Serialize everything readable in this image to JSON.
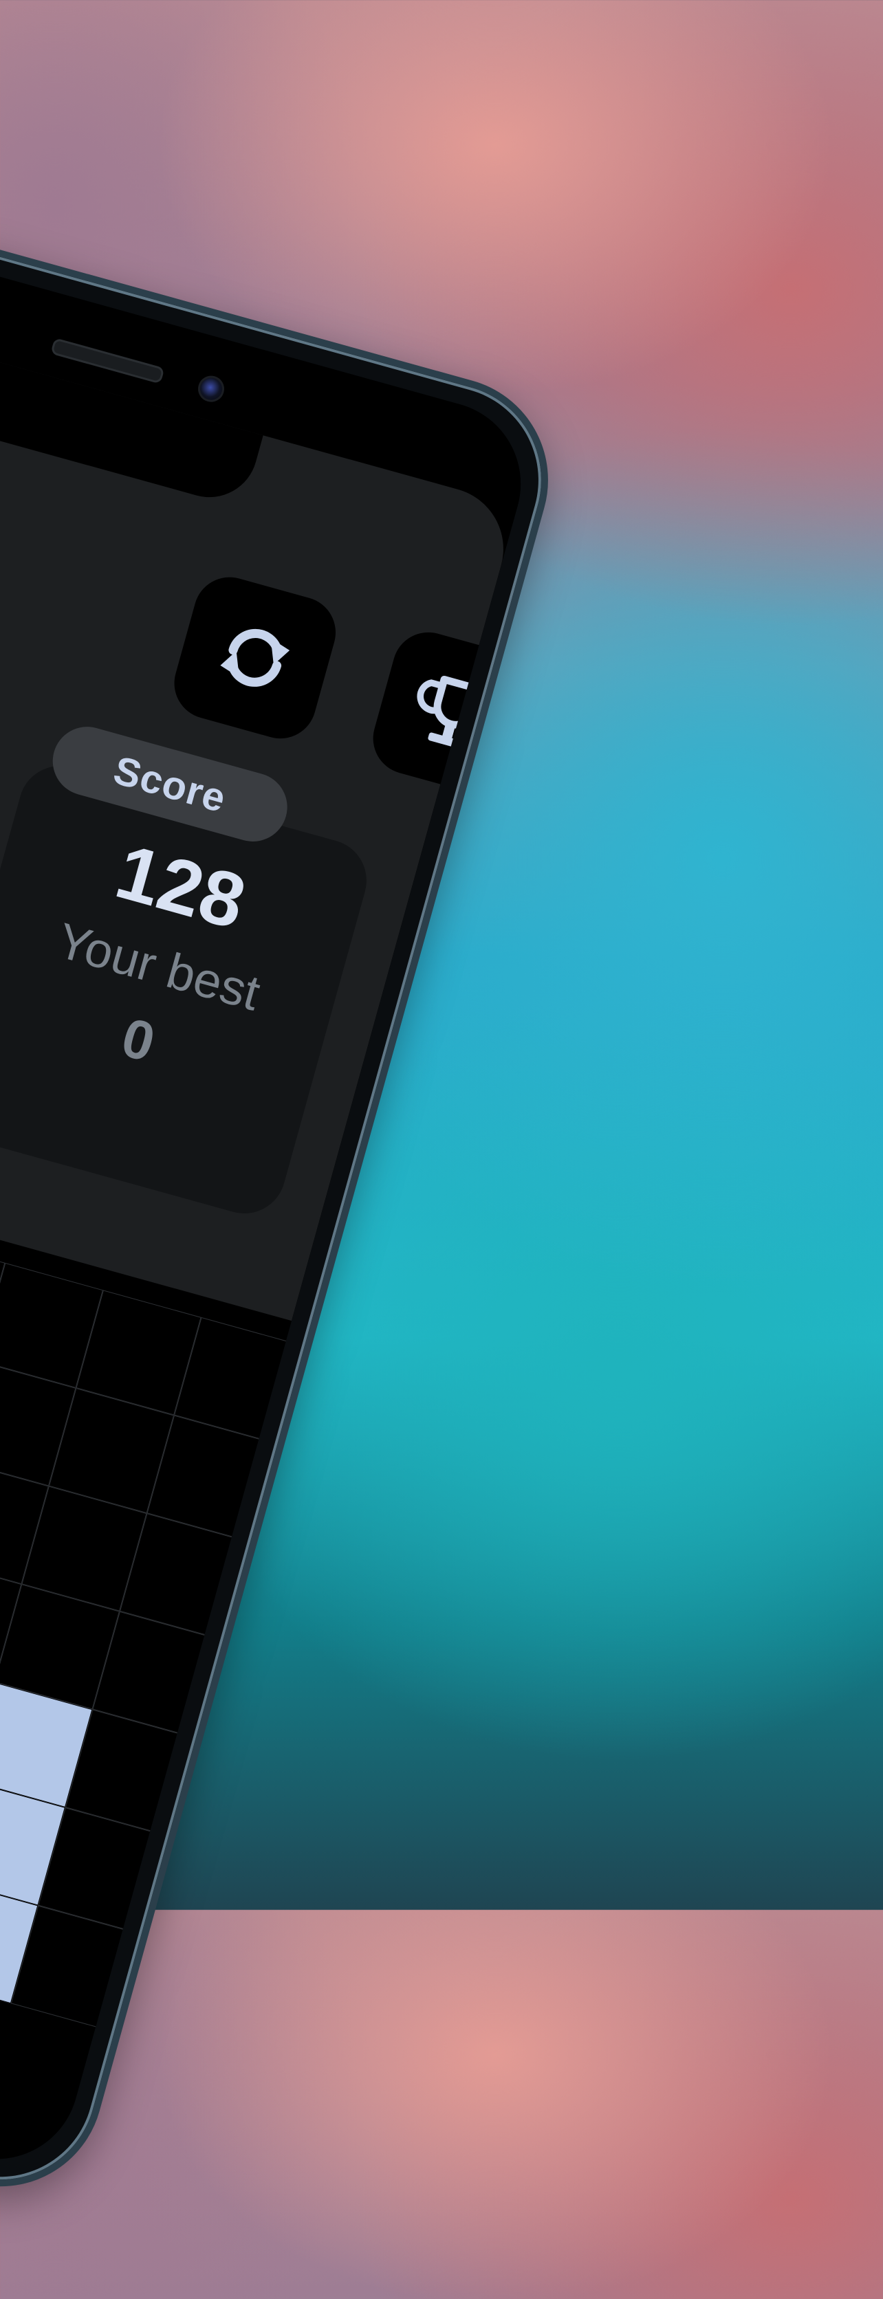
{
  "toolbar": {
    "refresh_icon": "refresh-icon",
    "trophy_icon": "trophy-icon"
  },
  "score": {
    "label": "Score",
    "value": "128",
    "best_label": "Your best",
    "best_value": "0"
  },
  "colors": {
    "panel": "#1d1f21",
    "card": "#131517",
    "accent_text": "#c7d4ec",
    "tile_light": "#b3c7e8",
    "tile_blue": "#4285e8"
  },
  "board": {
    "rows": [
      [
        "empty",
        "empty",
        "empty",
        "empty",
        "empty",
        "empty",
        "empty",
        "empty"
      ],
      [
        "empty",
        "empty",
        "empty",
        "empty",
        "empty",
        "empty",
        "empty",
        "empty"
      ],
      [
        "empty",
        "empty",
        "empty",
        "empty",
        "empty",
        "empty",
        "empty",
        "empty"
      ],
      [
        "empty",
        "empty",
        "empty",
        "light",
        "empty",
        "empty",
        "empty",
        "empty"
      ],
      [
        "empty",
        "empty",
        "empty",
        "empty",
        "empty",
        "empty",
        "light",
        "empty"
      ],
      [
        "empty",
        "empty",
        "blue",
        "blue",
        "blue",
        "blue",
        "light",
        "empty"
      ],
      [
        "empty",
        "empty",
        "blue",
        "blue",
        "light",
        "light",
        "light",
        "empty"
      ]
    ]
  }
}
